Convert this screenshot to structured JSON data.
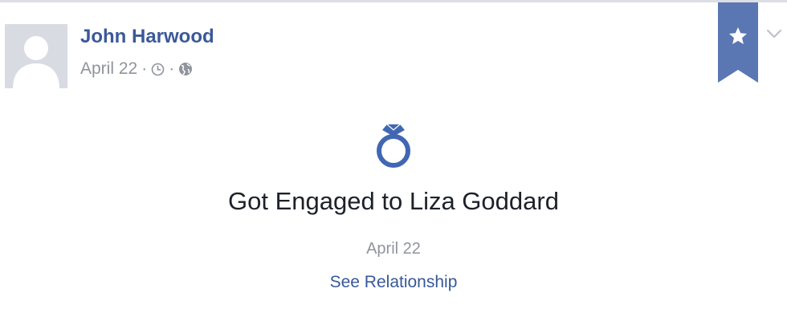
{
  "post": {
    "author": "John Harwood",
    "date": "April 22",
    "separator": "·",
    "clock_icon": "clock-icon",
    "audience_icon": "globe-icon"
  },
  "bookmark": {
    "icon": "star-icon",
    "color": "#5b77b3"
  },
  "menu": {
    "icon": "chevron-down-icon"
  },
  "life_event": {
    "icon": "ring-icon",
    "title": "Got Engaged to Liza Goddard",
    "date": "April 22",
    "link": "See Relationship"
  },
  "colors": {
    "link": "#3b5998",
    "muted": "#90949c",
    "text": "#1d2129",
    "ring": "#4267b2"
  }
}
